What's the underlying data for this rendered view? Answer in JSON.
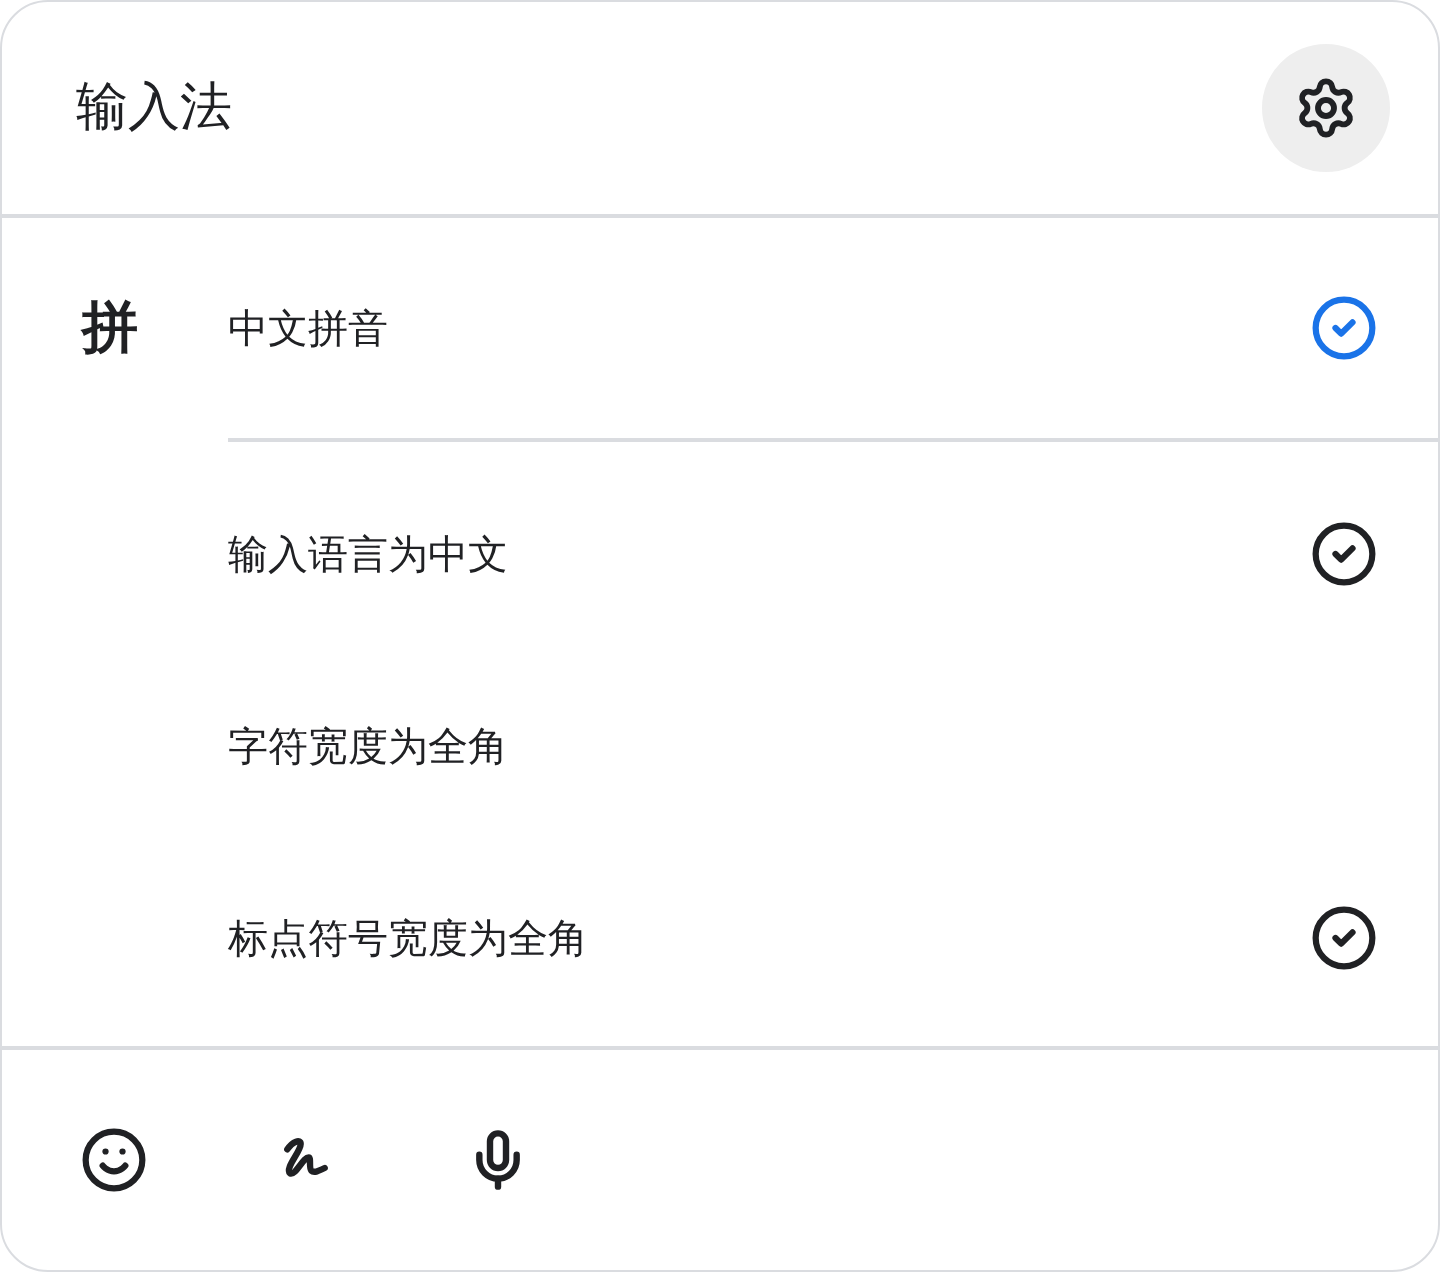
{
  "title": "输入法",
  "input_method": {
    "symbol": "拼",
    "name": "中文拼音",
    "selected": true
  },
  "options": [
    {
      "label": "输入语言为中文",
      "checked": true
    },
    {
      "label": "字符宽度为全角",
      "checked": false
    },
    {
      "label": "标点符号宽度为全角",
      "checked": true
    }
  ],
  "footer_tools": [
    {
      "kind": "emoji"
    },
    {
      "kind": "handwriting"
    },
    {
      "kind": "voice"
    }
  ]
}
